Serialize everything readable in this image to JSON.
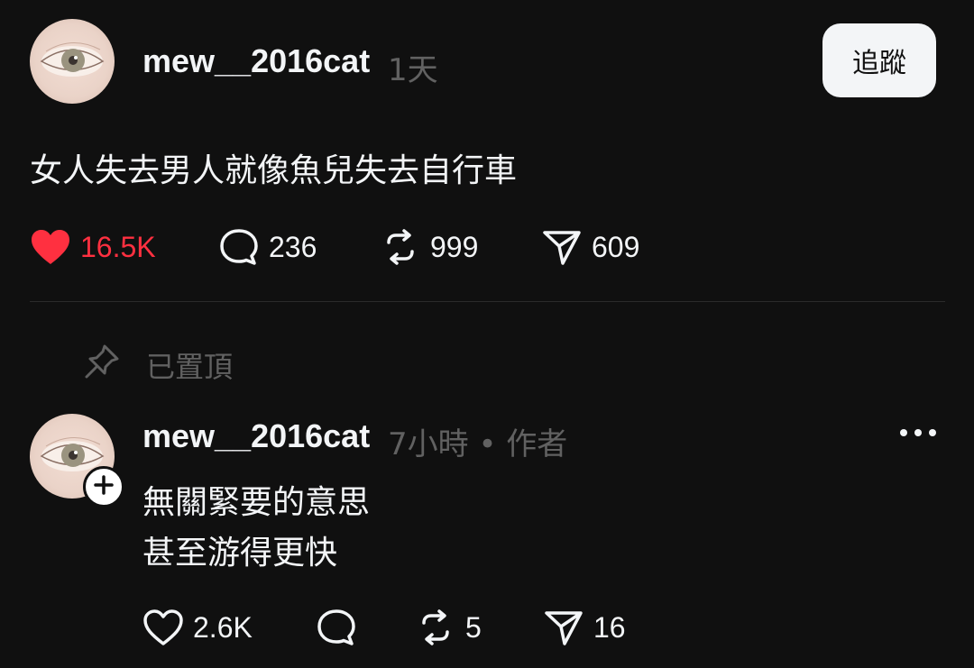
{
  "post": {
    "username": "mew__2016cat",
    "time": "1天",
    "follow_label": "追蹤",
    "text": "女人失去男人就像魚兒失去自行車",
    "likes": "16.5K",
    "comments": "236",
    "reposts": "999",
    "shares": "609"
  },
  "pinned": {
    "label": "已置頂"
  },
  "reply": {
    "username": "mew__2016cat",
    "meta": "7小時 • 作者",
    "line1": "無關緊要的意思",
    "line2": "甚至游得更快",
    "likes": "2.6K",
    "reposts": "5",
    "shares": "16"
  },
  "colors": {
    "background": "#101010",
    "text": "#f3f5f7",
    "muted": "#616161",
    "like_active": "#ff3040"
  },
  "icons": [
    "heart-icon",
    "comment-icon",
    "repost-icon",
    "share-icon",
    "pin-icon",
    "plus-icon",
    "more-icon"
  ]
}
